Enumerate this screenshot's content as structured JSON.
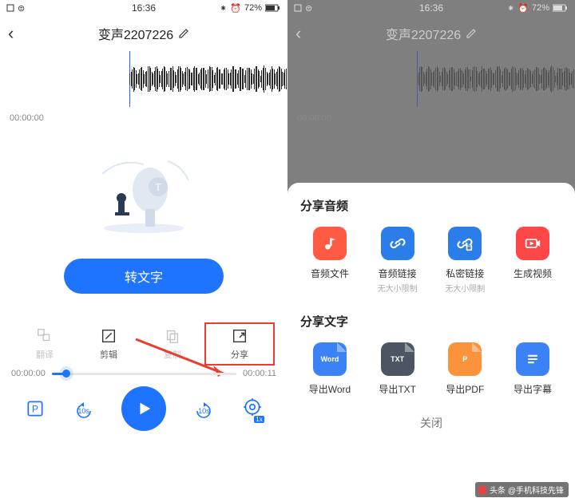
{
  "status": {
    "time": "16:36",
    "battery": "72%"
  },
  "header": {
    "title": "变声2207226"
  },
  "timestamp": "00:00:00",
  "cta_label": "转文字",
  "actions": {
    "translate": "翻译",
    "edit": "剪辑",
    "copy": "复制",
    "share": "分享"
  },
  "scrubber": {
    "start": "00:00:00",
    "end": "00:00:11"
  },
  "controls": {
    "back10": "10s",
    "fwd10": "10s",
    "speed": "1x"
  },
  "share_sheet": {
    "section_audio": "分享音频",
    "section_text": "分享文字",
    "audio_items": [
      {
        "label": "音频文件",
        "sub": "",
        "color": "#ff5a44"
      },
      {
        "label": "音频链接",
        "sub": "无大小限制",
        "color": "#2b7de9"
      },
      {
        "label": "私密链接",
        "sub": "无大小限制",
        "color": "#2b7de9"
      },
      {
        "label": "生成视频",
        "sub": "",
        "color": "#ff4747"
      }
    ],
    "text_items": [
      {
        "label": "导出Word",
        "badge": "Word",
        "color": "#3b82f6"
      },
      {
        "label": "导出TXT",
        "badge": "TXT",
        "color": "#4b5563"
      },
      {
        "label": "导出PDF",
        "badge": "P",
        "color": "#fb923c"
      },
      {
        "label": "导出字幕",
        "badge": "",
        "color": "#3b82f6"
      }
    ],
    "close_label": "关闭"
  },
  "watermark": "头条 @手机科技先锋"
}
